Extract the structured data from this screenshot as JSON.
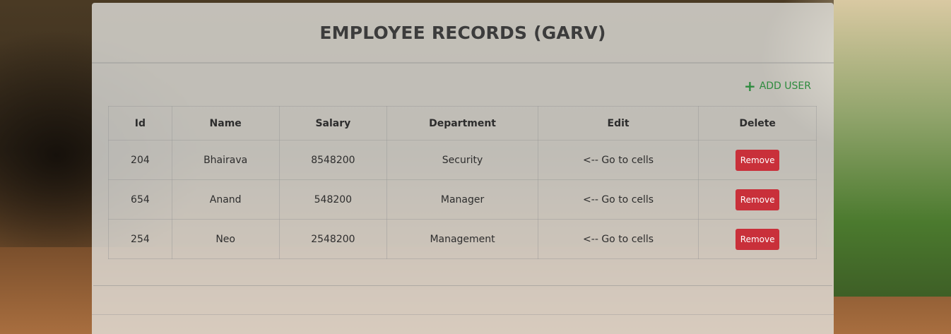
{
  "page": {
    "title": "EMPLOYEE RECORDS (GARV)"
  },
  "toolbar": {
    "add_user_icon": "+",
    "add_user_label": "ADD USER"
  },
  "table": {
    "headers": [
      "Id",
      "Name",
      "Salary",
      "Department",
      "Edit",
      "Delete"
    ],
    "rows": [
      {
        "id": "204",
        "name": "Bhairava",
        "salary": "8548200",
        "department": "Security",
        "edit": "<-- Go to cells",
        "delete": "Remove"
      },
      {
        "id": "654",
        "name": "Anand",
        "salary": "548200",
        "department": "Manager",
        "edit": "<-- Go to cells",
        "delete": "Remove"
      },
      {
        "id": "254",
        "name": "Neo",
        "salary": "2548200",
        "department": "Management",
        "edit": "<-- Go to cells",
        "delete": "Remove"
      }
    ]
  },
  "colors": {
    "accent_green": "#2e8b3e",
    "remove_red": "#c9303a"
  }
}
